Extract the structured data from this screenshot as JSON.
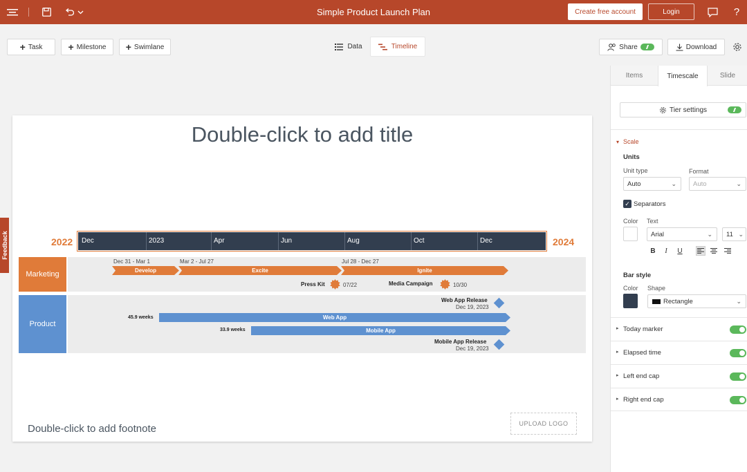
{
  "topbar": {
    "title": "Simple Product Launch Plan",
    "create_account_label": "Create free account",
    "login_label": "Login",
    "icons": [
      "menu-icon",
      "save-icon",
      "undo-icon",
      "chevron-down-icon",
      "comment-icon",
      "help-icon"
    ]
  },
  "toolbar": {
    "task_label": "Task",
    "milestone_label": "Milestone",
    "swimlane_label": "Swimlane",
    "data_tab_label": "Data",
    "timeline_tab_label": "Timeline",
    "share_label": "Share",
    "download_label": "Download"
  },
  "slide": {
    "title": "Double-click to add title",
    "footnote": "Double-click to add footnote",
    "upload_logo": "UPLOAD LOGO",
    "start_year": "2022",
    "end_year": "2024",
    "scale_labels": [
      "Dec",
      "2023",
      "Apr",
      "Jun",
      "Aug",
      "Oct",
      "Dec"
    ],
    "swimlanes": [
      {
        "name": "Marketing",
        "color": "#e07b39",
        "tasks": [
          {
            "name": "Develop",
            "range": "Dec 31 - Mar 1"
          },
          {
            "name": "Excite",
            "range": "Mar 2 - Jul 27"
          },
          {
            "name": "Ignite",
            "range": "Jul 28 - Dec 27"
          }
        ],
        "milestones": [
          {
            "name": "Press Kit",
            "date": "07/22"
          },
          {
            "name": "Media Campaign",
            "date": "10/30"
          }
        ]
      },
      {
        "name": "Product",
        "color": "#5e91d0",
        "milestones": [
          {
            "name": "Web App Release",
            "date": "Dec 19, 2023"
          },
          {
            "name": "Mobile App Release",
            "date": "Dec 19, 2023"
          }
        ],
        "tasks": [
          {
            "name": "Web App",
            "duration": "45.9 weeks"
          },
          {
            "name": "Mobile App",
            "duration": "33.9 weeks"
          }
        ]
      }
    ]
  },
  "panel": {
    "tabs": [
      "Items",
      "Timescale",
      "Slide"
    ],
    "tier_settings_label": "Tier settings",
    "scale_header": "Scale",
    "units_label": "Units",
    "unit_type_label": "Unit type",
    "unit_type_value": "Auto",
    "format_label": "Format",
    "format_value": "Auto",
    "separators_label": "Separators",
    "color_label": "Color",
    "text_label": "Text",
    "font_value": "Arial",
    "font_size_value": "11",
    "bold": "B",
    "italic": "I",
    "underline": "U",
    "bar_style_label": "Bar style",
    "bar_color_label": "Color",
    "shape_label": "Shape",
    "shape_value": "Rectangle",
    "toggles": [
      "Today marker",
      "Elapsed time",
      "Left end cap",
      "Right end cap"
    ]
  },
  "feedback_label": "Feedback",
  "colors": {
    "brand": "#b7472a",
    "accent_orange": "#e07b39",
    "accent_blue": "#5e91d0",
    "scale_dark": "#323e4f",
    "toggle_green": "#5bb85b"
  }
}
